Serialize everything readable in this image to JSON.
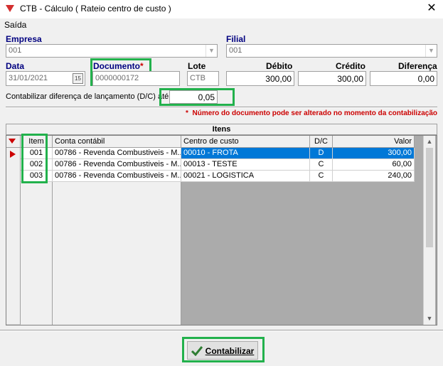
{
  "window": {
    "title": "CTB - Cálculo ( Rateio centro de custo )",
    "close_label": "✕"
  },
  "menu": {
    "items": [
      "Saída"
    ]
  },
  "form": {
    "empresa_label": "Empresa",
    "empresa_value": "001",
    "filial_label": "Filial",
    "filial_value": "001",
    "data_label": "Data",
    "data_value": "31/01/2021",
    "documento_label": "Documento",
    "documento_required": "*",
    "documento_value": "0000000172",
    "lote_label": "Lote",
    "lote_value": "CTB",
    "debito_label": "Débito",
    "debito_value": "300,00",
    "credito_label": "Crédito",
    "credito_value": "300,00",
    "diferenca_label": "Diferença",
    "diferenca_value": "0,00",
    "contab_label": "Contabilizar diferença de lançamento (D/C) até:",
    "contab_value": "0,05",
    "warning_star": "*",
    "warning_text": "Número do documento pode ser alterado no momento da contabilização"
  },
  "grid": {
    "title": "Itens",
    "columns": [
      "Item",
      "Conta contábil",
      "Centro de custo",
      "D/C",
      "Valor"
    ],
    "rows": [
      {
        "item": "001",
        "conta": "00786 - Revenda Combustiveis - M...",
        "centro": "00010 - FROTA",
        "dc": "D",
        "valor": "300,00"
      },
      {
        "item": "002",
        "conta": "00786 - Revenda Combustiveis - M...",
        "centro": "00013 - TESTE",
        "dc": "C",
        "valor": "60,00"
      },
      {
        "item": "003",
        "conta": "00786 - Revenda Combustiveis - M...",
        "centro": "00021 - LOGISTICA",
        "dc": "C",
        "valor": "240,00"
      }
    ]
  },
  "actions": {
    "contabilizar_label": "Contabilizar"
  },
  "colors": {
    "highlight": "#22b14c",
    "selection": "#0078d7",
    "label": "#000080",
    "warning": "#cc0000"
  }
}
